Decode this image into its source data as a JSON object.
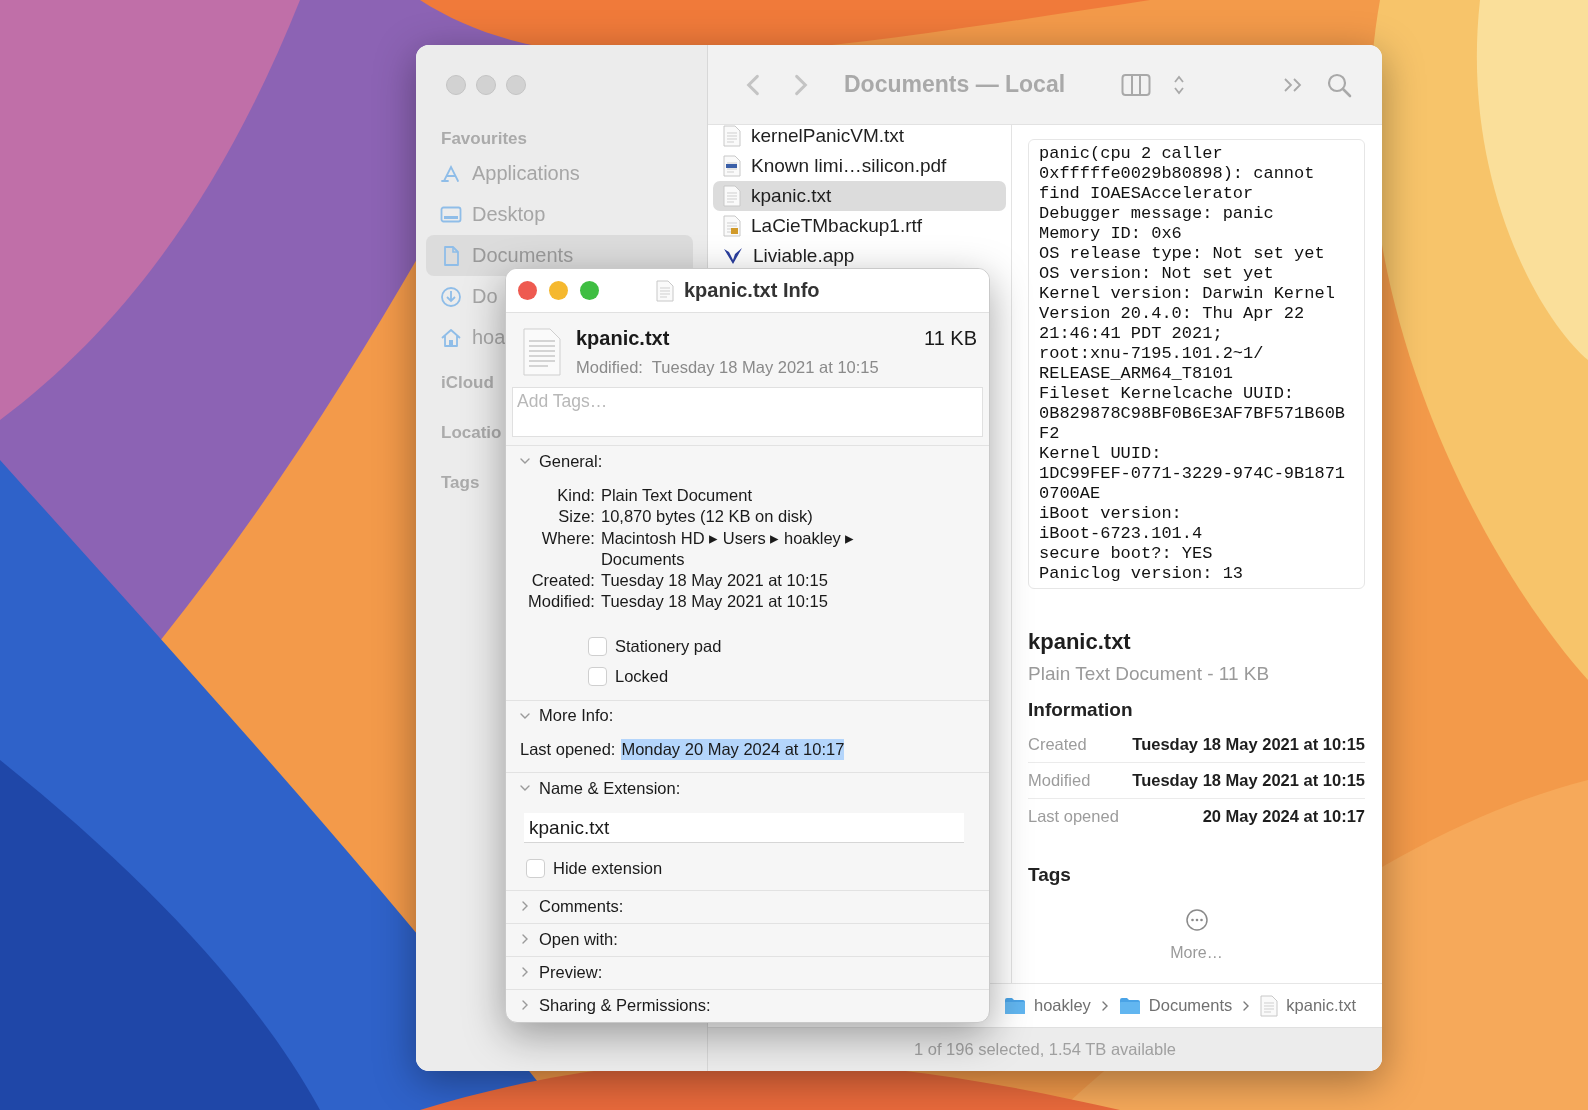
{
  "finder": {
    "title": "Documents — Local",
    "sidebar": [
      {
        "heading": "Favourites",
        "items": [
          {
            "label": "Applications",
            "selected": false
          },
          {
            "label": "Desktop",
            "selected": false
          },
          {
            "label": "Documents",
            "selected": true
          },
          {
            "label": "Do",
            "selected": false
          },
          {
            "label": "hoa",
            "selected": false
          }
        ]
      },
      {
        "heading": "iCloud"
      },
      {
        "heading": "Locatio"
      },
      {
        "heading": "Tags"
      }
    ],
    "files": [
      {
        "name": "kernelPanicVM.txt",
        "selected": false
      },
      {
        "name": "Known limi…silicon.pdf",
        "selected": false
      },
      {
        "name": "kpanic.txt",
        "selected": true
      },
      {
        "name": "LaCieTMbackup1.rtf",
        "selected": false
      },
      {
        "name": "Liviable.app",
        "selected": false
      }
    ],
    "preview": {
      "lines": [
        "panic(cpu 2 caller",
        "0xfffffe0029b80898): cannot",
        "find IOAESAccelerator",
        "Debugger message: panic",
        "Memory ID: 0x6",
        "OS release type: Not set yet",
        "OS version: Not set yet",
        "Kernel version: Darwin Kernel",
        "Version 20.4.0: Thu Apr 22",
        "21:46:41 PDT 2021;",
        "root:xnu-7195.101.2~1/",
        "RELEASE_ARM64_T8101",
        "Fileset Kernelcache UUID:",
        "0B829878C98BF0B6E3AF7BF571B60B",
        "F2",
        "Kernel UUID:",
        "1DC99FEF-0771-3229-974C-9B1871",
        "0700AE",
        "iBoot version:",
        "iBoot-6723.101.4",
        "secure boot?: YES",
        "Paniclog version: 13"
      ],
      "name": "kpanic.txt",
      "summary": "Plain Text Document - 11 KB",
      "info_heading": "Information",
      "info": [
        {
          "label": "Created",
          "value": "Tuesday 18 May 2021 at 10:15"
        },
        {
          "label": "Modified",
          "value": "Tuesday 18 May 2021 at 10:15"
        },
        {
          "label": "Last opened",
          "value": "20 May 2024 at 10:17"
        }
      ],
      "tags_heading": "Tags",
      "more_label": "More…"
    },
    "path_bar": [
      {
        "label": "hoakley"
      },
      {
        "label": "Documents"
      },
      {
        "label": "kpanic.txt"
      }
    ],
    "status_bar": "1 of 196 selected, 1.54 TB available"
  },
  "info_window": {
    "title": "kpanic.txt Info",
    "name": "kpanic.txt",
    "size": "11 KB",
    "modified": "Modified:  Tuesday 18 May 2021 at 10:15",
    "tags_placeholder": "Add Tags…",
    "sections": [
      {
        "kind": "general",
        "title": "General:",
        "expanded": true,
        "rows": [
          {
            "label": "Kind:",
            "value": "Plain Text Document",
            "highlighted": false
          },
          {
            "label": "Size:",
            "value": "10,870 bytes (12 KB on disk)",
            "highlighted": false
          },
          {
            "label": "Where:",
            "value": "Macintosh HD ▸ Users ▸ hoakley ▸ Documents",
            "highlighted": false
          },
          {
            "label": "Created:",
            "value": "Tuesday 18 May 2021 at 10:15",
            "highlighted": false
          },
          {
            "label": "Modified:",
            "value": "Tuesday 18 May 2021 at 10:15",
            "highlighted": false
          }
        ],
        "checkboxes": [
          {
            "label": "Stationery pad",
            "checked": false
          },
          {
            "label": "Locked",
            "checked": false
          }
        ]
      },
      {
        "kind": "inline",
        "title": "More Info:",
        "expanded": true,
        "rows": [
          {
            "label": "Last opened:",
            "value": "Monday 20 May 2024 at 10:17",
            "highlighted": true
          }
        ]
      },
      {
        "kind": "inline",
        "title": "Name & Extension:",
        "expanded": true,
        "field": "kpanic.txt",
        "checkboxes": [
          {
            "label": "Hide extension",
            "checked": false
          }
        ]
      },
      {
        "kind": "inline",
        "title": "Comments:",
        "expanded": false
      },
      {
        "kind": "inline",
        "title": "Open with:",
        "expanded": false
      },
      {
        "kind": "inline",
        "title": "Preview:",
        "expanded": false
      },
      {
        "kind": "inline",
        "title": "Sharing & Permissions:",
        "expanded": false
      }
    ]
  }
}
